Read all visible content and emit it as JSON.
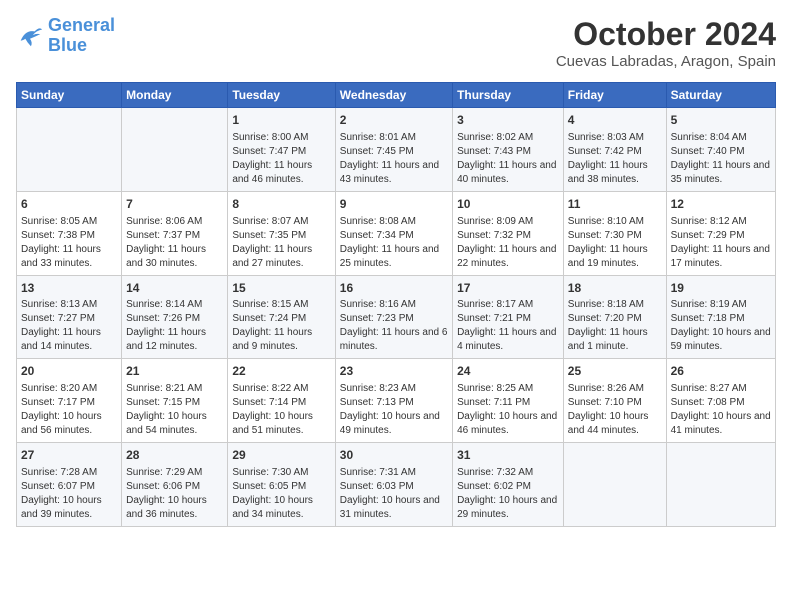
{
  "header": {
    "logo": {
      "line1": "General",
      "line2": "Blue"
    },
    "title": "October 2024",
    "subtitle": "Cuevas Labradas, Aragon, Spain"
  },
  "weekdays": [
    "Sunday",
    "Monday",
    "Tuesday",
    "Wednesday",
    "Thursday",
    "Friday",
    "Saturday"
  ],
  "weeks": [
    [
      {
        "day": "",
        "info": ""
      },
      {
        "day": "",
        "info": ""
      },
      {
        "day": "1",
        "info": "Sunrise: 8:00 AM\nSunset: 7:47 PM\nDaylight: 11 hours and 46 minutes."
      },
      {
        "day": "2",
        "info": "Sunrise: 8:01 AM\nSunset: 7:45 PM\nDaylight: 11 hours and 43 minutes."
      },
      {
        "day": "3",
        "info": "Sunrise: 8:02 AM\nSunset: 7:43 PM\nDaylight: 11 hours and 40 minutes."
      },
      {
        "day": "4",
        "info": "Sunrise: 8:03 AM\nSunset: 7:42 PM\nDaylight: 11 hours and 38 minutes."
      },
      {
        "day": "5",
        "info": "Sunrise: 8:04 AM\nSunset: 7:40 PM\nDaylight: 11 hours and 35 minutes."
      }
    ],
    [
      {
        "day": "6",
        "info": "Sunrise: 8:05 AM\nSunset: 7:38 PM\nDaylight: 11 hours and 33 minutes."
      },
      {
        "day": "7",
        "info": "Sunrise: 8:06 AM\nSunset: 7:37 PM\nDaylight: 11 hours and 30 minutes."
      },
      {
        "day": "8",
        "info": "Sunrise: 8:07 AM\nSunset: 7:35 PM\nDaylight: 11 hours and 27 minutes."
      },
      {
        "day": "9",
        "info": "Sunrise: 8:08 AM\nSunset: 7:34 PM\nDaylight: 11 hours and 25 minutes."
      },
      {
        "day": "10",
        "info": "Sunrise: 8:09 AM\nSunset: 7:32 PM\nDaylight: 11 hours and 22 minutes."
      },
      {
        "day": "11",
        "info": "Sunrise: 8:10 AM\nSunset: 7:30 PM\nDaylight: 11 hours and 19 minutes."
      },
      {
        "day": "12",
        "info": "Sunrise: 8:12 AM\nSunset: 7:29 PM\nDaylight: 11 hours and 17 minutes."
      }
    ],
    [
      {
        "day": "13",
        "info": "Sunrise: 8:13 AM\nSunset: 7:27 PM\nDaylight: 11 hours and 14 minutes."
      },
      {
        "day": "14",
        "info": "Sunrise: 8:14 AM\nSunset: 7:26 PM\nDaylight: 11 hours and 12 minutes."
      },
      {
        "day": "15",
        "info": "Sunrise: 8:15 AM\nSunset: 7:24 PM\nDaylight: 11 hours and 9 minutes."
      },
      {
        "day": "16",
        "info": "Sunrise: 8:16 AM\nSunset: 7:23 PM\nDaylight: 11 hours and 6 minutes."
      },
      {
        "day": "17",
        "info": "Sunrise: 8:17 AM\nSunset: 7:21 PM\nDaylight: 11 hours and 4 minutes."
      },
      {
        "day": "18",
        "info": "Sunrise: 8:18 AM\nSunset: 7:20 PM\nDaylight: 11 hours and 1 minute."
      },
      {
        "day": "19",
        "info": "Sunrise: 8:19 AM\nSunset: 7:18 PM\nDaylight: 10 hours and 59 minutes."
      }
    ],
    [
      {
        "day": "20",
        "info": "Sunrise: 8:20 AM\nSunset: 7:17 PM\nDaylight: 10 hours and 56 minutes."
      },
      {
        "day": "21",
        "info": "Sunrise: 8:21 AM\nSunset: 7:15 PM\nDaylight: 10 hours and 54 minutes."
      },
      {
        "day": "22",
        "info": "Sunrise: 8:22 AM\nSunset: 7:14 PM\nDaylight: 10 hours and 51 minutes."
      },
      {
        "day": "23",
        "info": "Sunrise: 8:23 AM\nSunset: 7:13 PM\nDaylight: 10 hours and 49 minutes."
      },
      {
        "day": "24",
        "info": "Sunrise: 8:25 AM\nSunset: 7:11 PM\nDaylight: 10 hours and 46 minutes."
      },
      {
        "day": "25",
        "info": "Sunrise: 8:26 AM\nSunset: 7:10 PM\nDaylight: 10 hours and 44 minutes."
      },
      {
        "day": "26",
        "info": "Sunrise: 8:27 AM\nSunset: 7:08 PM\nDaylight: 10 hours and 41 minutes."
      }
    ],
    [
      {
        "day": "27",
        "info": "Sunrise: 7:28 AM\nSunset: 6:07 PM\nDaylight: 10 hours and 39 minutes."
      },
      {
        "day": "28",
        "info": "Sunrise: 7:29 AM\nSunset: 6:06 PM\nDaylight: 10 hours and 36 minutes."
      },
      {
        "day": "29",
        "info": "Sunrise: 7:30 AM\nSunset: 6:05 PM\nDaylight: 10 hours and 34 minutes."
      },
      {
        "day": "30",
        "info": "Sunrise: 7:31 AM\nSunset: 6:03 PM\nDaylight: 10 hours and 31 minutes."
      },
      {
        "day": "31",
        "info": "Sunrise: 7:32 AM\nSunset: 6:02 PM\nDaylight: 10 hours and 29 minutes."
      },
      {
        "day": "",
        "info": ""
      },
      {
        "day": "",
        "info": ""
      }
    ]
  ]
}
